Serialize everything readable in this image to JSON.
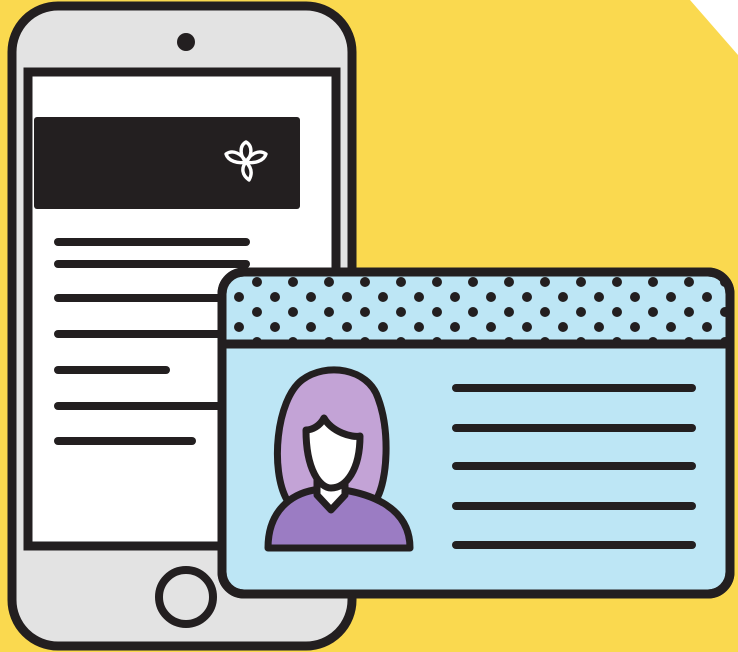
{
  "colors": {
    "background": "#fad94f",
    "corner_fold": "#ffffff",
    "outline": "#231f20",
    "phone_body": "#e3e3e3",
    "phone_screen": "#ffffff",
    "phone_banner": "#231f20",
    "logo_stroke": "#ffffff",
    "card_body": "#bde6f5",
    "card_dot": "#231f20",
    "avatar_hair": "#c3a3d6",
    "avatar_face": "#ffffff",
    "avatar_shirt": "#9b7cc3"
  },
  "phone": {
    "banner_logo": "trillium-icon",
    "text_line_count": 7
  },
  "id_card": {
    "header_pattern": "polka-dots",
    "avatar": "person-avatar-icon",
    "text_line_count": 5
  }
}
